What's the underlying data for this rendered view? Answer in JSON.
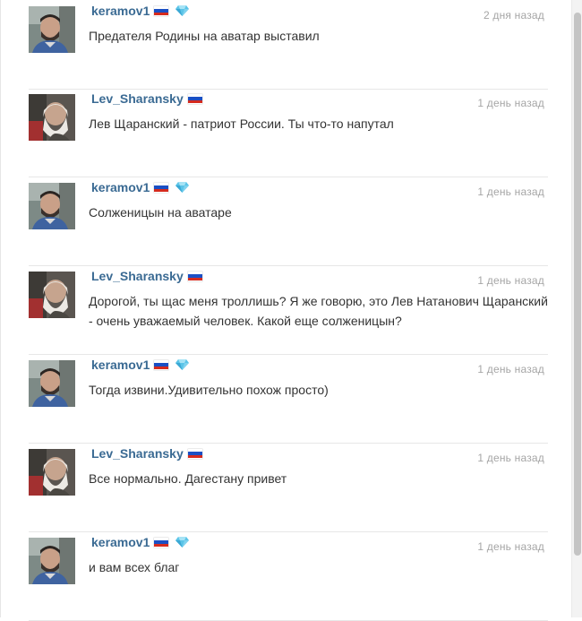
{
  "flag_colors": [
    "#ffffff",
    "#1a4fc4",
    "#d52b1e"
  ],
  "gem_color": "#5bc4e8",
  "comments": [
    {
      "author": "keramov1",
      "avatar": "keramov",
      "has_flag": true,
      "has_gem": true,
      "time": "2 дня назад",
      "text": "Предателя Родины на аватар выставил"
    },
    {
      "author": "Lev_Sharansky",
      "avatar": "sharansky",
      "has_flag": true,
      "has_gem": false,
      "time": "1 день назад",
      "text": "Лев Щаранский - патриот России. Ты что-то напутал"
    },
    {
      "author": "keramov1",
      "avatar": "keramov",
      "has_flag": true,
      "has_gem": true,
      "time": "1 день назад",
      "text": "Солженицын на аватаре"
    },
    {
      "author": "Lev_Sharansky",
      "avatar": "sharansky",
      "has_flag": true,
      "has_gem": false,
      "time": "1 день назад",
      "text": "Дорогой, ты щас меня троллишь? Я же говорю, это Лев Натанович Щаранский -  очень уважаемый человек. Какой еще солженицын?"
    },
    {
      "author": "keramov1",
      "avatar": "keramov",
      "has_flag": true,
      "has_gem": true,
      "time": "1 день назад",
      "text": "Тогда извини.Удивительно похож просто)"
    },
    {
      "author": "Lev_Sharansky",
      "avatar": "sharansky",
      "has_flag": true,
      "has_gem": false,
      "time": "1 день назад",
      "text": "Все нормально. Дагестану привет"
    },
    {
      "author": "keramov1",
      "avatar": "keramov",
      "has_flag": true,
      "has_gem": true,
      "time": "1 день назад",
      "text": "и вам всех благ"
    }
  ]
}
